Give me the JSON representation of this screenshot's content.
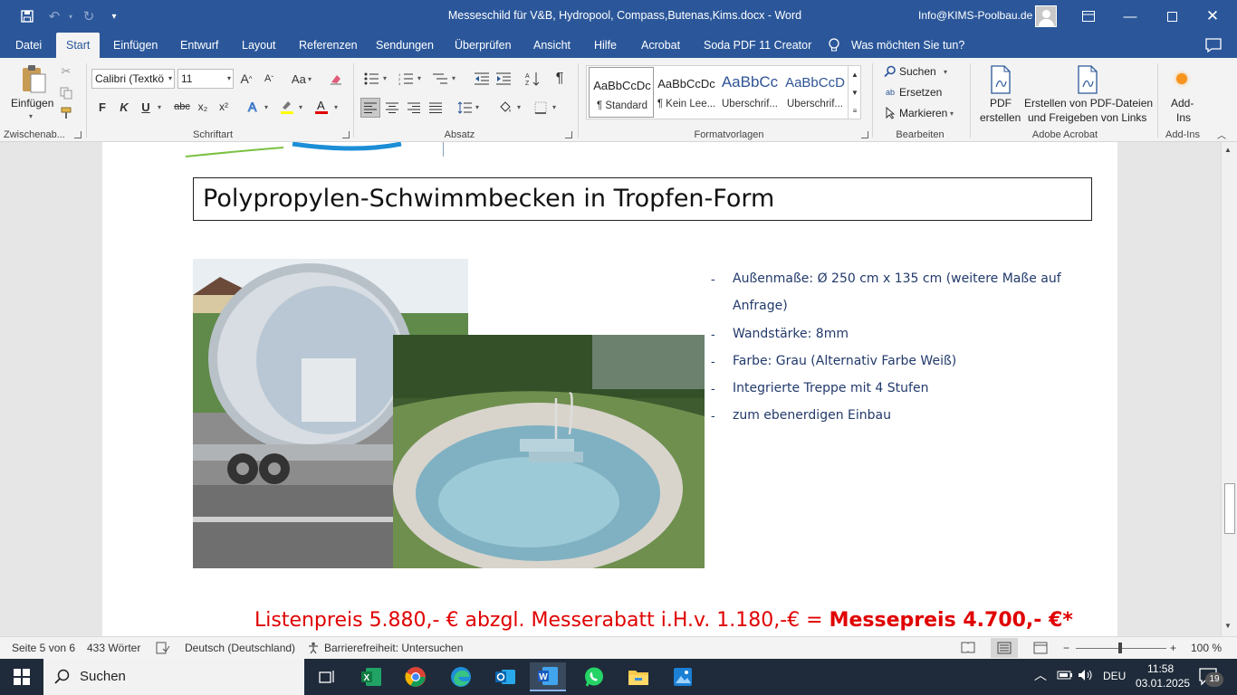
{
  "title_bar": {
    "doc_title": "Messeschild für V&B, Hydropool, Compass,Butenas,Kims.docx  -  Word",
    "user_name": "Info@KIMS-Poolbau.de"
  },
  "tabs": [
    "Datei",
    "Start",
    "Einfügen",
    "Entwurf",
    "Layout",
    "Referenzen",
    "Sendungen",
    "Überprüfen",
    "Ansicht",
    "Hilfe",
    "Acrobat",
    "Soda PDF 11 Creator"
  ],
  "tell_me": "Was möchten Sie tun?",
  "ribbon": {
    "clipboard": {
      "paste_label": "Einfügen",
      "group_label": "Zwischenab..."
    },
    "font": {
      "font_name": "Calibri (Textkö",
      "font_size": "11",
      "bold": "F",
      "italic": "K",
      "underline": "U",
      "strike": "abc",
      "subscript": "x₂",
      "superscript": "x²",
      "grow": "A",
      "shrink": "A",
      "case": "Aa",
      "group_label": "Schriftart"
    },
    "paragraph": {
      "group_label": "Absatz",
      "pilcrow": "¶"
    },
    "styles": {
      "items": [
        {
          "preview": "AaBbCcDc",
          "name": "¶ Standard"
        },
        {
          "preview": "AaBbCcDc",
          "name": "¶ Kein Lee..."
        },
        {
          "preview": "AaBbCc",
          "name": "Überschrif..."
        },
        {
          "preview": "AaBbCcD",
          "name": "Überschrif..."
        }
      ],
      "group_label": "Formatvorlagen"
    },
    "editing": {
      "find": "Suchen",
      "replace": "Ersetzen",
      "select": "Markieren",
      "group_label": "Bearbeiten"
    },
    "acrobat": {
      "pdf_create_1": "PDF",
      "pdf_create_2": "erstellen",
      "pdf_share_1": "Erstellen von PDF-Dateien",
      "pdf_share_2": "und Freigeben von Links",
      "group_label": "Adobe Acrobat"
    },
    "addins": {
      "label_1": "Add-",
      "label_2": "Ins",
      "group_label": "Add-Ins"
    }
  },
  "document": {
    "heading": "Polypropylen-Schwimmbecken in Tropfen-Form",
    "bullets": [
      "Außenmaße: Ø 250 cm x 135 cm (weitere Maße auf",
      "Anfrage)",
      "Wandstärke: 8mm",
      "Farbe: Grau (Alternativ Farbe Weiß)",
      "Integrierte Treppe mit 4 Stufen",
      "zum ebenerdigen Einbau"
    ],
    "bullet_dash": "-",
    "price_normal": "Listenpreis 5.880,- € abzgl. Messerabatt i.H.v. 1.180,-€ = ",
    "price_bold": "Messepreis 4.700,- €*"
  },
  "status_bar": {
    "page": "Seite 5 von 6",
    "words": "433 Wörter",
    "language": "Deutsch (Deutschland)",
    "accessibility": "Barrierefreiheit: Untersuchen",
    "zoom": "100 %"
  },
  "taskbar": {
    "search": "Suchen",
    "lang": "DEU",
    "time": "11:58",
    "date": "03.01.2025",
    "notif_count": "19"
  },
  "colors": {
    "word_blue": "#2b579a",
    "price_red": "#e00000",
    "bullet_text": "#223a6b"
  }
}
